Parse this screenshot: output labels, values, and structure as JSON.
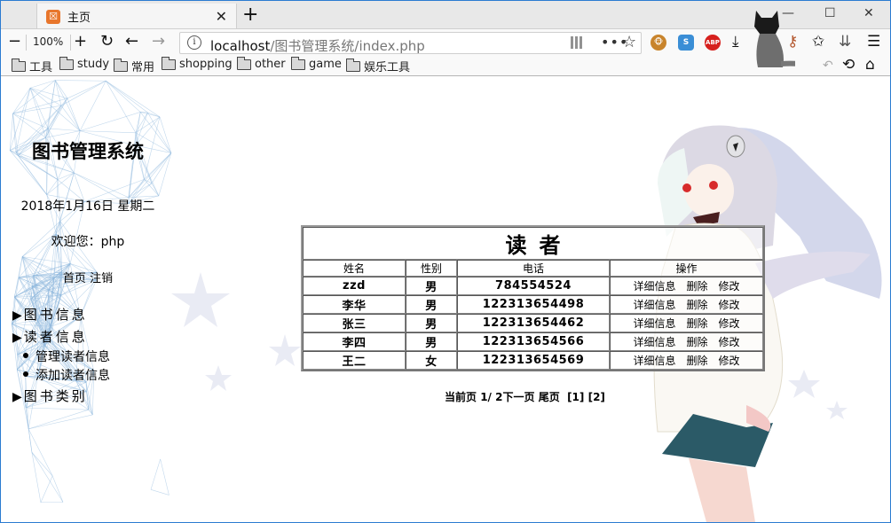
{
  "browser": {
    "tab": {
      "title": "主页",
      "favicon": "xampp-icon"
    },
    "new_tab_label": "+",
    "window_controls": {
      "minimize": "—",
      "maximize": "☐",
      "close": "✕"
    },
    "zoom_level": "100%",
    "url": {
      "host": "localhost",
      "path": "/图书管理系统/index.php"
    },
    "extensions": [
      {
        "name": "tampermonkey-icon",
        "label": "🐵",
        "color": "#c8842c"
      },
      {
        "name": "s-extension-icon",
        "label": "S",
        "color": "#3a8ed6"
      },
      {
        "name": "adblock-plus-icon",
        "label": "ABP",
        "color": "#d6201d"
      }
    ],
    "bookmarks": [
      "工具",
      "study",
      "常用",
      "shopping",
      "other",
      "game",
      "娱乐工具"
    ]
  },
  "sidebar": {
    "title": "图书管理系统",
    "date": "2018年1月16日 星期二",
    "welcome": "欢迎您：php",
    "links": {
      "home": "首页",
      "logout": "注销"
    },
    "menu": [
      {
        "label": "图书信息",
        "marker": "▶"
      },
      {
        "label": "读者信息",
        "marker": "▶",
        "children": [
          "管理读者信息",
          "添加读者信息"
        ]
      },
      {
        "label": "图书类别",
        "marker": "▶"
      }
    ]
  },
  "table": {
    "caption": "读者",
    "headers": [
      "姓名",
      "性别",
      "电话",
      "操作"
    ],
    "actions": [
      "详细信息",
      "删除",
      "修改"
    ],
    "rows": [
      {
        "name": "zzd",
        "gender": "男",
        "phone": "784554524"
      },
      {
        "name": "李华",
        "gender": "男",
        "phone": "122313654498"
      },
      {
        "name": "张三",
        "gender": "男",
        "phone": "122313654462"
      },
      {
        "name": "李四",
        "gender": "男",
        "phone": "122313654566"
      },
      {
        "name": "王二",
        "gender": "女",
        "phone": "122313654569"
      }
    ]
  },
  "pager": {
    "current_label": "当前页",
    "current": "1/",
    "total": "2",
    "next": "下一页",
    "last": "尾页",
    "pages": [
      "[1]",
      "[2]"
    ]
  }
}
